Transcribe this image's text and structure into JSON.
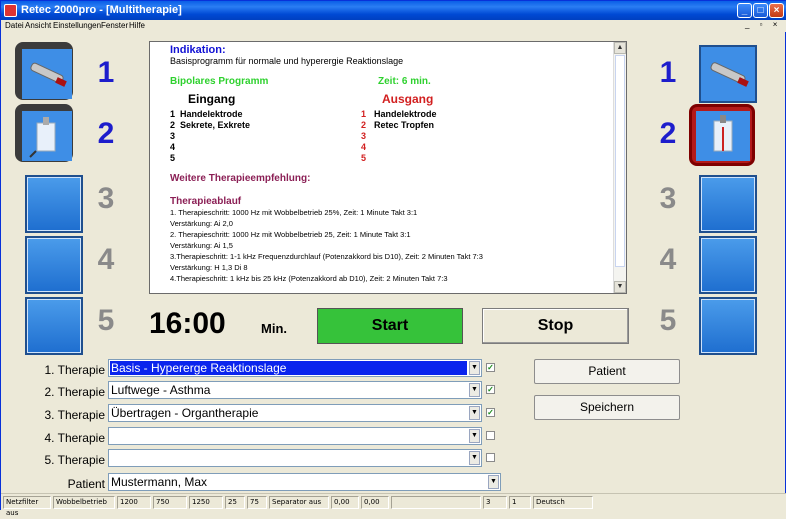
{
  "window": {
    "title": "Retec 2000pro - [Multitherapie]"
  },
  "menu": [
    "Datei",
    "Ansicht",
    "Einstellungen",
    "Fenster",
    "Hilfe"
  ],
  "menu_right": "_ ▫ ×",
  "left_slots": [
    "1",
    "2",
    "3",
    "4",
    "5"
  ],
  "right_slots": [
    "1",
    "2",
    "3",
    "4",
    "5"
  ],
  "info": {
    "indikation_label": "Indikation:",
    "indikation_text": "Basisprogramm für normale und hyperergie Reaktionslage",
    "program": "Bipolares Programm",
    "zeit": "Zeit:  6 min.",
    "eingang_head": "Eingang",
    "ausgang_head": "Ausgang",
    "rows": [
      {
        "n": "1",
        "in": "Handelektrode",
        "out": "Handelektrode"
      },
      {
        "n": "2",
        "in": "Sekrete, Exkrete",
        "out": "Retec Tropfen"
      },
      {
        "n": "3",
        "in": "",
        "out": ""
      },
      {
        "n": "4",
        "in": "",
        "out": ""
      },
      {
        "n": "5",
        "in": "",
        "out": ""
      }
    ],
    "weitere": "Weitere Therapieempfehlung:",
    "ablauf_head": "Therapieablauf",
    "ablauf_lines": [
      "1. Therapieschritt: 1000 Hz mit Wobbelbetrieb 25%, Zeit: 1 Minute   Takt 3:1",
      "Verstärkung: Ai 2,0",
      "2. Therapieschritt: 1000 Hz mit Wobbelbetrieb 25, Zeit: 1 Minute  Takt 3:1",
      "Verstärkung: Ai 1,5",
      "3.Therapieschritt: 1-1 kHz Frequenzdurchlauf (Potenzakkord bis D10), Zeit: 2 Minuten  Takt 7:3",
      "Verstärkung: H 1,3  Di 8",
      "4.Therapieschritt: 1 kHz bis 25 kHz (Potenzakkord ab D10), Zeit: 2 Minuten Takt 7:3"
    ]
  },
  "timer": {
    "value": "16:00",
    "unit": "Min."
  },
  "buttons": {
    "start": "Start",
    "stop": "Stop",
    "patient": "Patient",
    "save": "Speichern"
  },
  "therapies": [
    {
      "label": "1. Therapie",
      "value": "Basis - Hyperergе Reaktionslage",
      "checked": true,
      "selected": true
    },
    {
      "label": "2. Therapie",
      "value": "Luftwege - Asthma",
      "checked": true,
      "selected": false
    },
    {
      "label": "3. Therapie",
      "value": "Übertragen - Organtherapie",
      "checked": true,
      "selected": false
    },
    {
      "label": "4. Therapie",
      "value": "",
      "checked": false,
      "selected": false
    },
    {
      "label": "5. Therapie",
      "value": "",
      "checked": false,
      "selected": false
    }
  ],
  "patient": {
    "label": "Patient",
    "value": "Mustermann, Max"
  },
  "status": [
    "Netzfilter aus",
    "Wobbelbetrieb",
    "1200",
    "750",
    "1250",
    "25",
    "75",
    "Separator aus",
    "0,00",
    "0,00",
    "",
    "3",
    "1",
    "Deutsch"
  ],
  "colors": {
    "accent": "#2d7ad1",
    "start": "#36c23a",
    "selection": "#0a24ed",
    "alert_frame": "#b31a1a"
  }
}
